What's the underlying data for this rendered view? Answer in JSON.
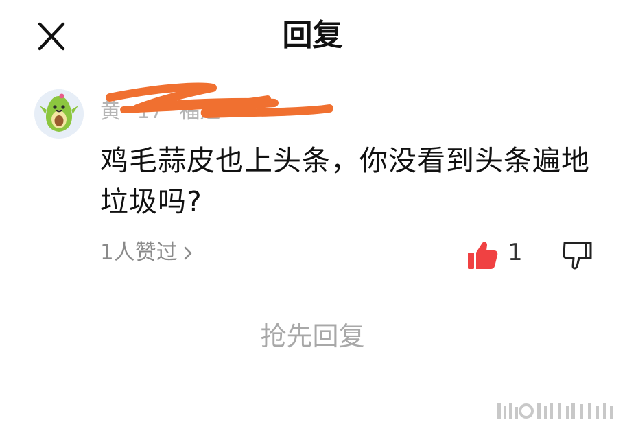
{
  "header": {
    "title": "回复",
    "close_icon": "close-icon"
  },
  "comment": {
    "author_name": "黄",
    "date": "17",
    "location": "福建",
    "content": "鸡毛蒜皮也上头条，你没看到头条遍地垃圾吗?",
    "likes_summary": "1人赞过",
    "like_count": "1"
  },
  "reply": {
    "prompt": "抢先回复"
  },
  "colors": {
    "like_red": "#f04142",
    "scribble_orange": "#f07030",
    "avatar_green": "#8cc63f",
    "muted_text": "#8a8a8a"
  }
}
